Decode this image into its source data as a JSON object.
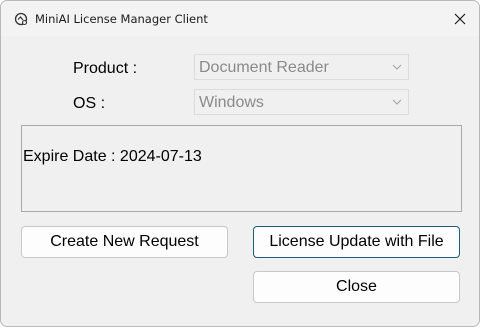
{
  "window": {
    "title": "MiniAI License Manager Client",
    "app_icon": "miniai-logo-icon",
    "close_icon": "close-icon"
  },
  "form": {
    "product_label": "Product :",
    "product_value": "Document Reader",
    "os_label": "OS :",
    "os_value": "Windows"
  },
  "info": {
    "expire_text": "Expire Date : 2024-07-13"
  },
  "buttons": {
    "create_request": "Create New Request",
    "license_update": "License Update with File",
    "close": "Close"
  },
  "colors": {
    "window_bg": "#f0f0f0",
    "focus_border": "#1a5f7a",
    "disabled_text": "#8a8a8a"
  }
}
